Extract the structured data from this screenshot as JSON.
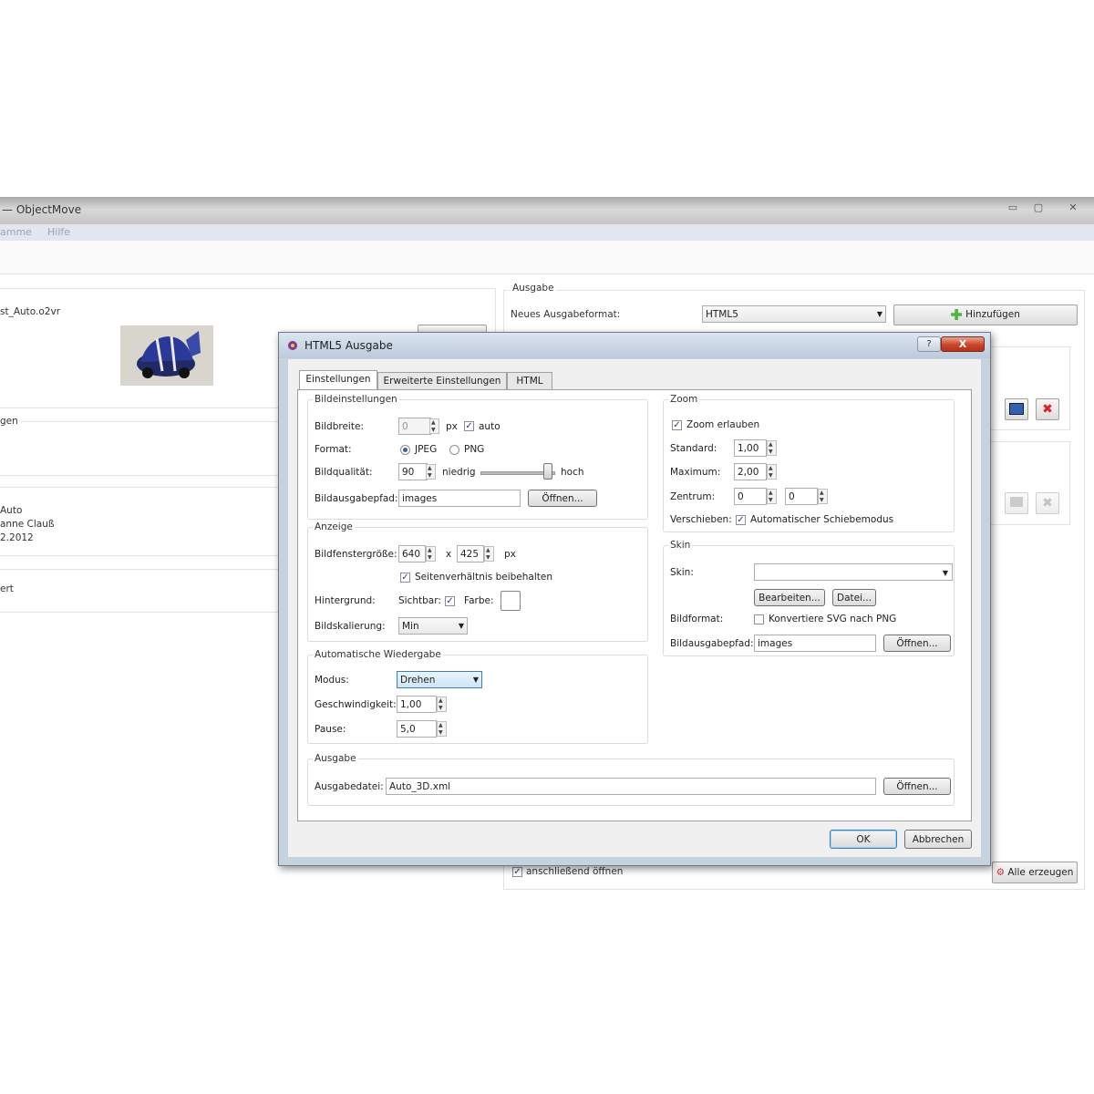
{
  "app": {
    "title": "— ObjectMove",
    "window_buttons": [
      "▭",
      "▢",
      "✕"
    ],
    "menu": [
      "amme",
      "Hilfe"
    ],
    "left": {
      "file_name": "st_Auto.o2vr",
      "section1_label": "gen",
      "info_lines": [
        "Auto",
        "anne Clauß",
        "2.2012"
      ],
      "section2_label": "ert"
    },
    "output": {
      "title": "Ausgabe",
      "new_format_label": "Neues Ausgabeformat:",
      "format_value": "HTML5",
      "add_button": "Hinzufügen",
      "open_after_label": "anschließend öffnen",
      "create_all_button": "Alle erzeugen"
    }
  },
  "dialog": {
    "title": "HTML5 Ausgabe",
    "help_button": "?",
    "close_button": "X",
    "tabs": [
      "Einstellungen",
      "Erweiterte Einstellungen",
      "HTML"
    ],
    "bild": {
      "title": "Bildeinstellungen",
      "width_label": "Bildbreite:",
      "width_value": "0",
      "width_unit": "px",
      "auto_label": "auto",
      "format_label": "Format:",
      "jpeg_label": "JPEG",
      "png_label": "PNG",
      "quality_label": "Bildqualität:",
      "quality_value": "90",
      "low_label": "niedrig",
      "high_label": "hoch",
      "quality_slider": 0.9,
      "path_label": "Bildausgabepfad:",
      "path_value": "images",
      "open_button": "Öffnen..."
    },
    "anzeige": {
      "title": "Anzeige",
      "size_label": "Bildfenstergröße:",
      "size_w": "640",
      "size_x": "x",
      "size_h": "425",
      "size_unit": "px",
      "keep_ratio_label": "Seitenverhältnis beibehalten",
      "bg_label": "Hintergrund:",
      "visible_label": "Sichtbar:",
      "color_label": "Farbe:",
      "scale_label": "Bildskalierung:",
      "scale_value": "Min"
    },
    "auto": {
      "title": "Automatische Wiedergabe",
      "mode_label": "Modus:",
      "mode_value": "Drehen",
      "speed_label": "Geschwindigkeit:",
      "speed_value": "1,00",
      "pause_label": "Pause:",
      "pause_value": "5,0"
    },
    "zoom": {
      "title": "Zoom",
      "allow_label": "Zoom erlauben",
      "standard_label": "Standard:",
      "standard_value": "1,00",
      "max_label": "Maximum:",
      "max_value": "2,00",
      "center_label": "Zentrum:",
      "center_x": "0",
      "center_y": "0",
      "move_label": "Verschieben:",
      "auto_move_label": "Automatischer Schiebemodus"
    },
    "skin": {
      "title": "Skin",
      "skin_label": "Skin:",
      "skin_value": "",
      "edit_button": "Bearbeiten...",
      "file_button": "Datei...",
      "format_label": "Bildformat:",
      "convert_label": "Konvertiere SVG nach PNG",
      "path_label": "Bildausgabepfad:",
      "path_value": "images",
      "open_button": "Öffnen..."
    },
    "ausgabe": {
      "title": "Ausgabe",
      "file_label": "Ausgabedatei:",
      "file_value": "Auto_3D.xml",
      "open_button": "Öffnen..."
    },
    "ok_button": "OK",
    "cancel_button": "Abbrechen"
  }
}
